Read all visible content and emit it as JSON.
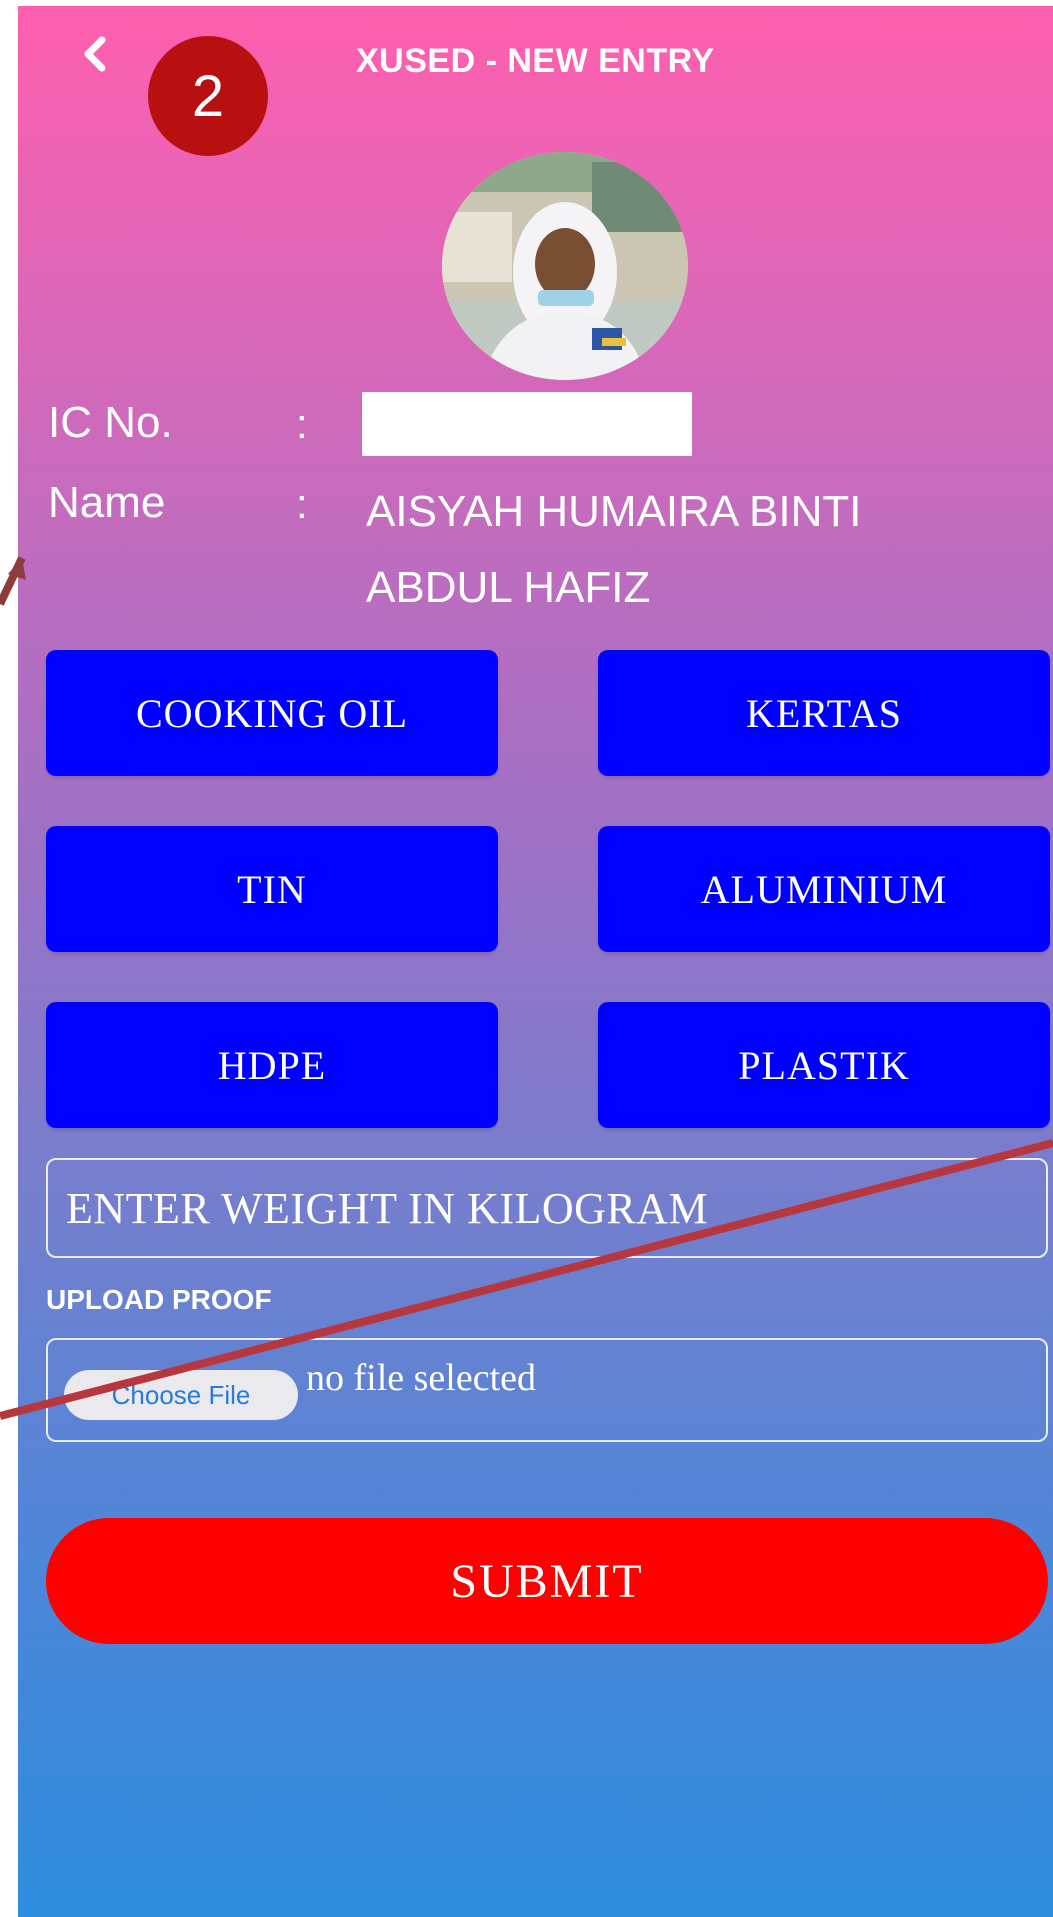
{
  "header": {
    "title": "XUSED - NEW ENTRY",
    "back_icon": "chevron-left-icon",
    "step_number": "2"
  },
  "profile": {
    "photo": "student-photo",
    "ic_label": "IC No.",
    "ic_separator": ":",
    "ic_value": "",
    "name_label": "Name",
    "name_separator": ":",
    "name_value": "AISYAH HUMAIRA BINTI ABDUL HAFIZ"
  },
  "categories": [
    "COOKING OIL",
    "KERTAS",
    "TIN",
    "ALUMINIUM",
    "HDPE",
    "PLASTIK"
  ],
  "weight": {
    "placeholder": "ENTER WEIGHT IN KILOGRAM",
    "value": ""
  },
  "upload": {
    "label": "UPLOAD PROOF",
    "choose_label": "Choose File",
    "status": "no file selected"
  },
  "submit_label": "SUBMIT",
  "colors": {
    "gradient_top": "#ff5fae",
    "gradient_bottom": "#2e8ddd",
    "category_button": "#0000ff",
    "submit_button": "#ff0000",
    "step_badge": "#b80f10",
    "annotation_arrow": "#b8363d"
  }
}
